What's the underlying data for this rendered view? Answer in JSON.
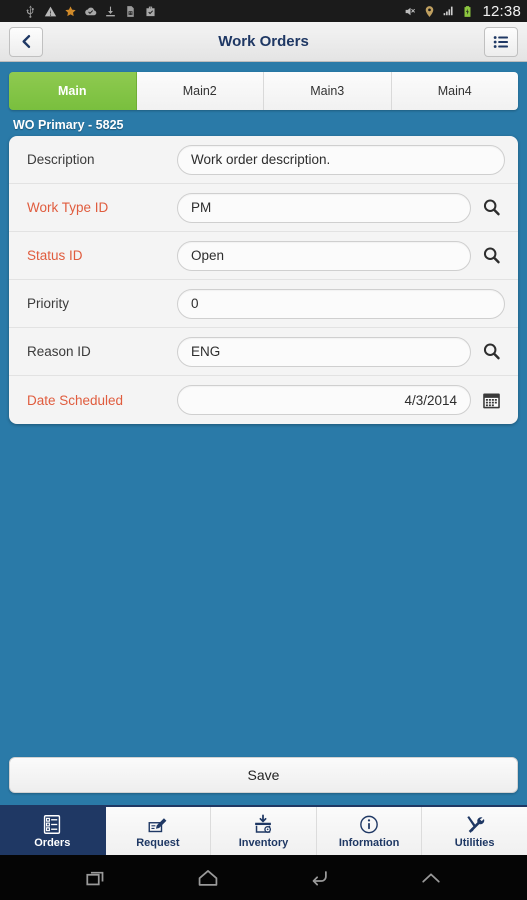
{
  "statusbar": {
    "clock": "12:38",
    "left_icons": [
      "usb-icon",
      "warning-icon",
      "star-icon",
      "cloud-check-icon",
      "download-icon",
      "sim-card-icon",
      "briefcase-check-icon"
    ],
    "right_icons": [
      "mute-icon",
      "gps-icon",
      "signal-icon",
      "battery-charging-icon"
    ]
  },
  "titlebar": {
    "back_icon": "chevron-left-icon",
    "title": "Work Orders",
    "menu_icon": "list-menu-icon"
  },
  "tabs": [
    {
      "label": "Main",
      "active": true
    },
    {
      "label": "Main2",
      "active": false
    },
    {
      "label": "Main3",
      "active": false
    },
    {
      "label": "Main4",
      "active": false
    }
  ],
  "section": {
    "label": "WO Primary - 5825"
  },
  "form": {
    "fields": [
      {
        "label": "Description",
        "value": "Work order description.",
        "required": false,
        "icon": "none",
        "align": "left"
      },
      {
        "label": "Work Type ID",
        "value": "PM",
        "required": true,
        "icon": "search-icon",
        "align": "left"
      },
      {
        "label": "Status ID",
        "value": "Open",
        "required": true,
        "icon": "search-icon",
        "align": "left"
      },
      {
        "label": "Priority",
        "value": "0",
        "required": false,
        "icon": "none",
        "align": "left"
      },
      {
        "label": "Reason ID",
        "value": "ENG",
        "required": false,
        "icon": "search-icon",
        "align": "left"
      },
      {
        "label": "Date Scheduled",
        "value": "4/3/2014",
        "required": true,
        "icon": "calendar-icon",
        "align": "right"
      }
    ]
  },
  "save": {
    "label": "Save"
  },
  "appnav": [
    {
      "label": "Orders",
      "icon": "checklist-icon",
      "active": true
    },
    {
      "label": "Request",
      "icon": "edit-form-icon",
      "active": false
    },
    {
      "label": "Inventory",
      "icon": "box-gear-icon",
      "active": false
    },
    {
      "label": "Information",
      "icon": "info-circle-icon",
      "active": false
    },
    {
      "label": "Utilities",
      "icon": "tools-icon",
      "active": false
    }
  ],
  "sysnav": [
    {
      "icon": "recents-icon"
    },
    {
      "icon": "home-icon"
    },
    {
      "icon": "back-icon"
    },
    {
      "icon": "chevron-up-icon"
    }
  ],
  "colors": {
    "page_background": "#2a7aa8",
    "accent_navy": "#1f3864",
    "tab_active_green": "#79bf3e",
    "required_label": "#e05c3e",
    "card_background": "#f4f4f4"
  }
}
